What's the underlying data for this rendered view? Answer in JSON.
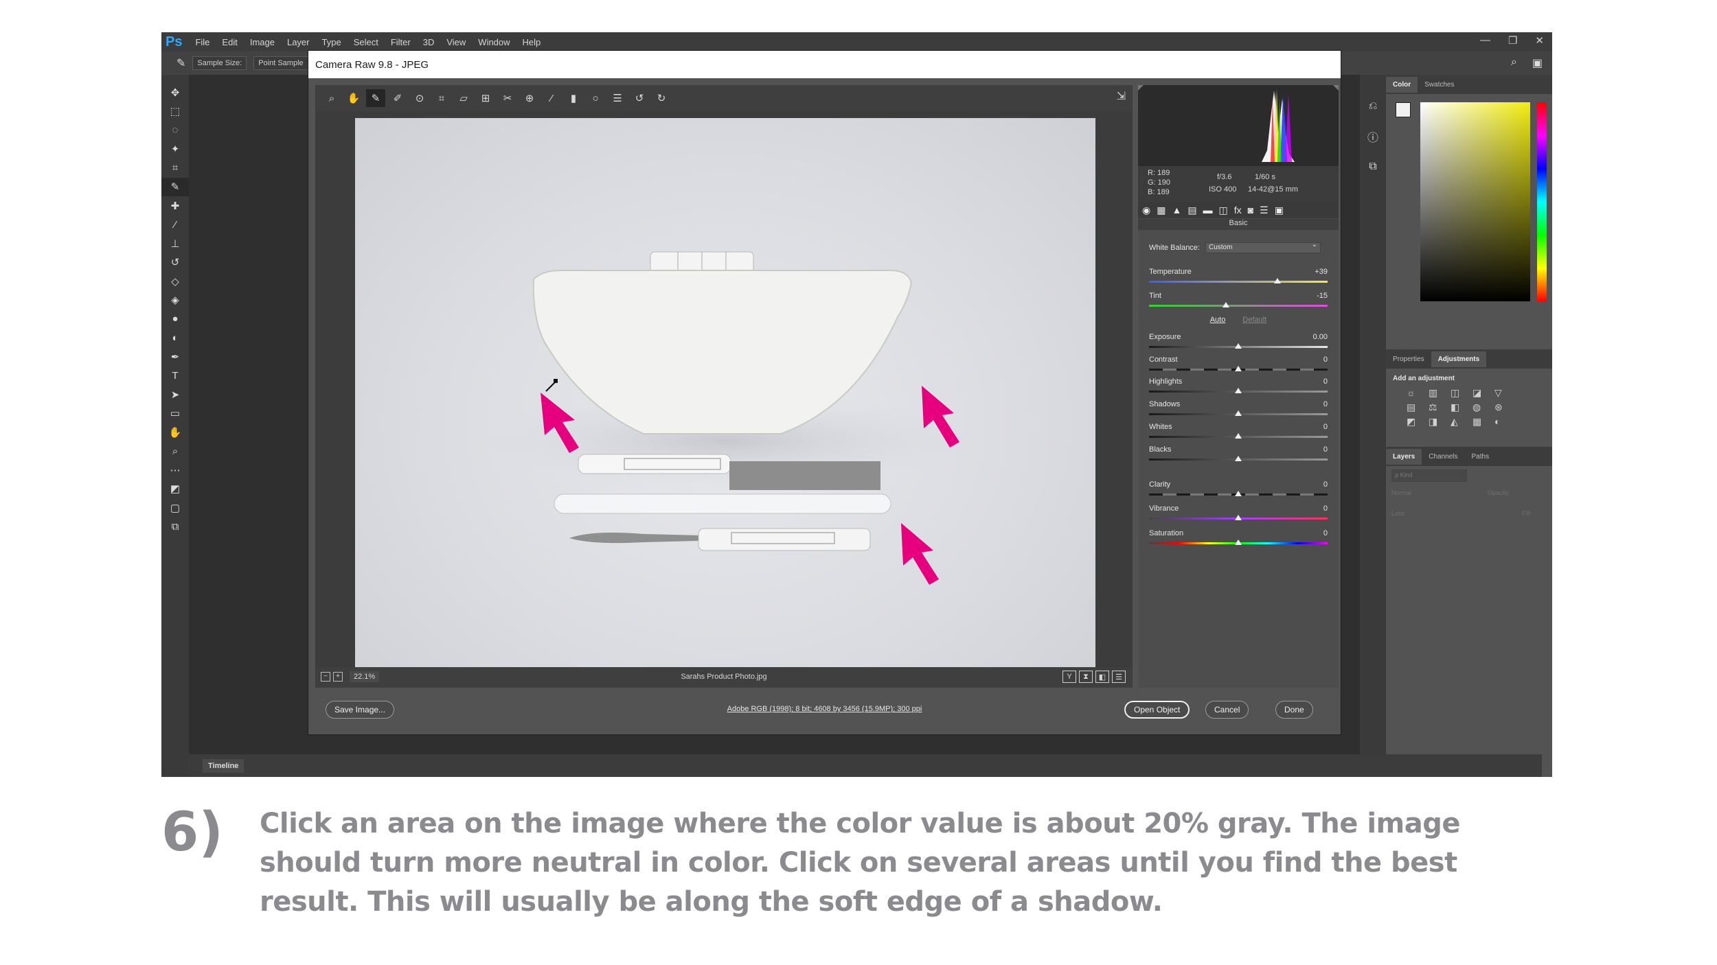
{
  "app": {
    "logo": "Ps",
    "menus": [
      "File",
      "Edit",
      "Image",
      "Layer",
      "Type",
      "Select",
      "Filter",
      "3D",
      "View",
      "Window",
      "Help"
    ],
    "window_controls": [
      "—",
      "❐",
      "✕"
    ]
  },
  "options_bar": {
    "sample_size": "Sample Size:",
    "point_sample": "Point Sample"
  },
  "timeline": {
    "tab": "Timeline"
  },
  "right_panels": {
    "color_tabs": [
      "Color",
      "Swatches"
    ],
    "adj_tabs": [
      "Properties",
      "Adjustments"
    ],
    "add_adjustment": "Add an adjustment",
    "layer_tabs": [
      "Layers",
      "Channels",
      "Paths"
    ],
    "kind_placeholder": "ρ Kind",
    "blend_mode": "Normal",
    "opacity_label": "Opacity:",
    "lock_label": "Lock:",
    "fill_label": "Fill:"
  },
  "camera_raw": {
    "title": "Camera Raw 9.8  -  JPEG",
    "meta": {
      "r": "R:  189",
      "g": "G:  190",
      "b": "B:  189",
      "aperture": "f/3.6",
      "shutter": "1/60 s",
      "iso": "ISO 400",
      "lens": "14-42@15 mm"
    },
    "panel_title": "Basic",
    "white_balance_label": "White Balance:",
    "white_balance_value": "Custom",
    "auto": "Auto",
    "default": "Default",
    "sliders": [
      {
        "label": "Temperature",
        "value": "+39",
        "pos": 0.72
      },
      {
        "label": "Tint",
        "value": "-15",
        "pos": 0.43
      },
      {
        "label": "Exposure",
        "value": "0.00",
        "pos": 0.5
      },
      {
        "label": "Contrast",
        "value": "0",
        "pos": 0.5
      },
      {
        "label": "Highlights",
        "value": "0",
        "pos": 0.5
      },
      {
        "label": "Shadows",
        "value": "0",
        "pos": 0.5
      },
      {
        "label": "Whites",
        "value": "0",
        "pos": 0.5
      },
      {
        "label": "Blacks",
        "value": "0",
        "pos": 0.5
      },
      {
        "label": "Clarity",
        "value": "0",
        "pos": 0.5
      },
      {
        "label": "Vibrance",
        "value": "0",
        "pos": 0.5
      },
      {
        "label": "Saturation",
        "value": "0",
        "pos": 0.5
      }
    ],
    "zoom": "22.1%",
    "filename": "Sarahs Product Photo.jpg",
    "view_buttons": [
      "Y",
      "⧗",
      "◧",
      "☰"
    ],
    "save_image": "Save Image...",
    "workflow": "Adobe RGB (1998); 8 bit; 4608 by 3456 (15.9MP); 300 ppi",
    "open_object": "Open Object",
    "cancel": "Cancel",
    "done": "Done"
  },
  "caption": {
    "number": "6)",
    "text": "Click an area on the image where the color value is about 20% gray. The image should turn more neutral in color. Click on several areas until you find the best result. This will usually be along the soft edge of a shadow."
  },
  "colors": {
    "arrow": "#e6007e",
    "ps_bg": "#535353",
    "caption": "#8a8a8f"
  }
}
